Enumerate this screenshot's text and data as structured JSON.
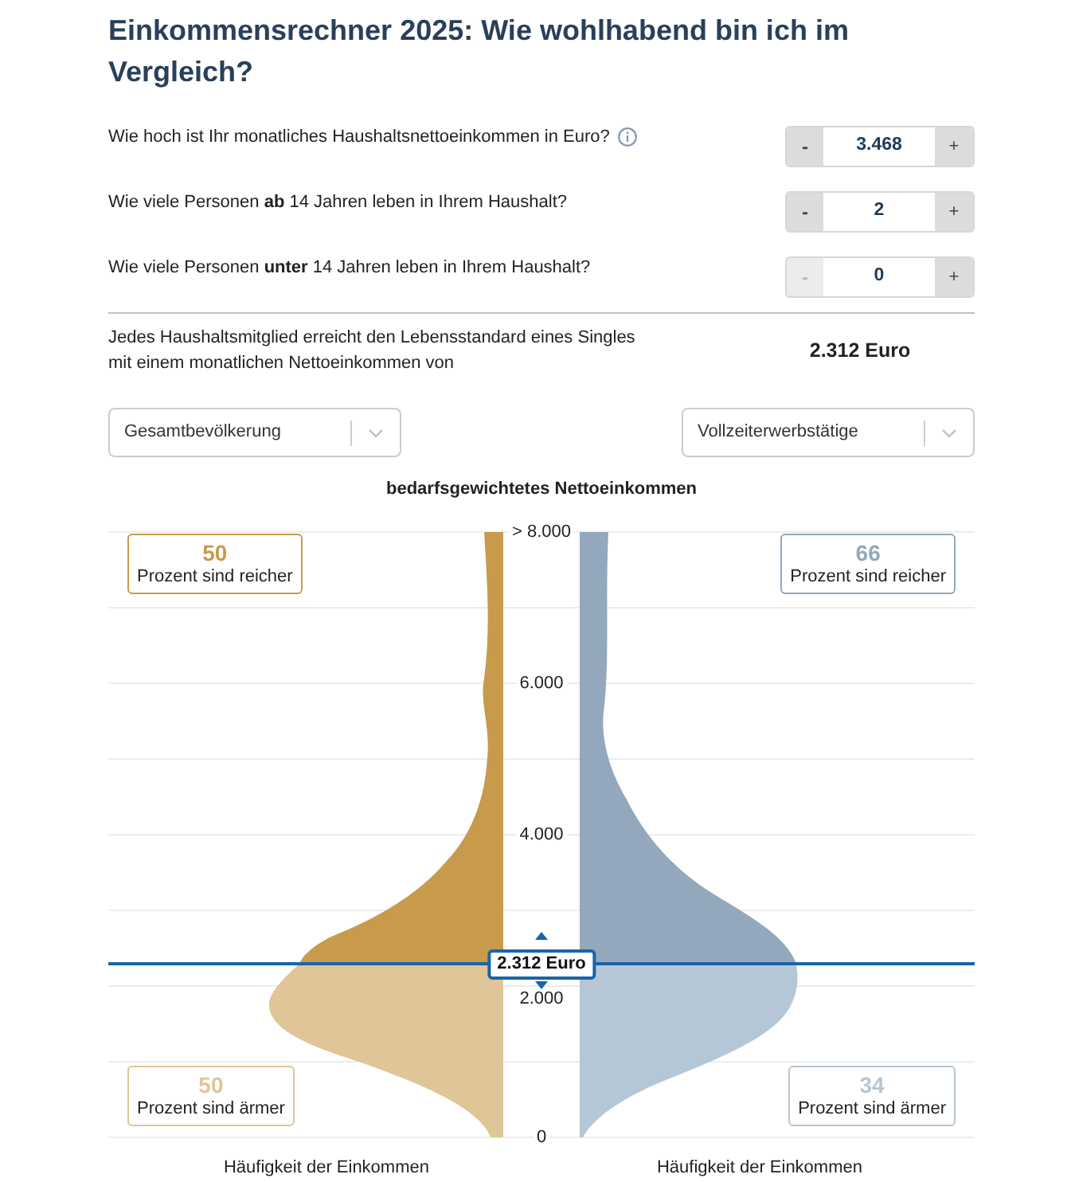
{
  "title": "Einkommensrechner 2025: Wie wohlhabend bin ich im Vergleich?",
  "questions": [
    {
      "text": "Wie hoch ist Ihr monatliches Haushaltsnettoeinkommen in Euro?",
      "info": true,
      "minus": "-",
      "value": "3.468",
      "plus": "+",
      "minus_disabled": false
    },
    {
      "text": "Wie viele Personen **ab** 14 Jahren leben in Ihrem Haushalt?",
      "info": false,
      "minus": "-",
      "value": "2",
      "plus": "+",
      "minus_disabled": false
    },
    {
      "text": "Wie viele Personen **unter** 14 Jahren leben in Ihrem Haushalt?",
      "info": false,
      "minus": "-",
      "value": "0",
      "plus": "+",
      "minus_disabled": true
    }
  ],
  "result": {
    "text": "Jedes Haushaltsmitglied erreicht den Lebensstandard eines Singles mit einem monatlichen Nettoeinkommen von",
    "value": "2.312 Euro"
  },
  "filters": [
    {
      "value": "Gesamtbevölkerung"
    },
    {
      "value": "Vollzeiterwerbstätige"
    }
  ],
  "chart": {
    "title": "bedarfsgewichtetes Nettoeinkommen",
    "y_tick_labels": [
      "> 8.000",
      "6.000",
      "4.000",
      "2.000",
      "0"
    ],
    "marker": {
      "label": "2.312 Euro"
    },
    "groups": [
      {
        "richer": {
          "percent": "50",
          "label": "Prozent sind reicher",
          "color": "#c89a4b"
        },
        "poorer": {
          "percent": "50",
          "label": "Prozent sind ärmer",
          "color": "#dfc597"
        },
        "axis_label": "Häufigkeit der Einkommen"
      },
      {
        "richer": {
          "percent": "66",
          "label": "Prozent sind reicher",
          "color": "#93a8bc"
        },
        "poorer": {
          "percent": "34",
          "label": "Prozent sind ärmer",
          "color": "#b5c7d6"
        },
        "axis_label": "Häufigkeit der Einkommen"
      }
    ]
  }
}
